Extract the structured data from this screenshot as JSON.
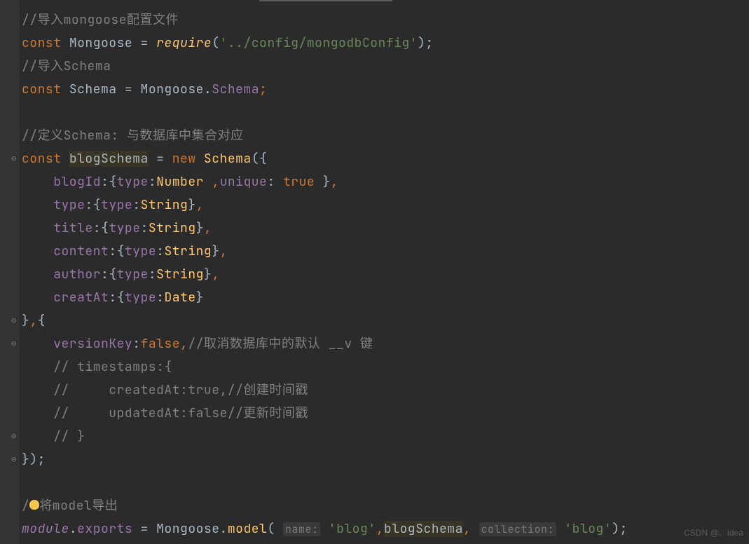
{
  "watermark": "CSDN @。Idea",
  "code_lines": [
    {
      "tokens": [
        {
          "t": "//导入mongoose配置文件",
          "c": "comment"
        }
      ]
    },
    {
      "tokens": [
        {
          "t": "const ",
          "c": "keyword"
        },
        {
          "t": "Mongoose ",
          "c": "identifier"
        },
        {
          "t": "= ",
          "c": "identifier"
        },
        {
          "t": "require",
          "c": "func-italic"
        },
        {
          "t": "(",
          "c": "identifier"
        },
        {
          "t": "'../config/mongodbConfig'",
          "c": "string"
        },
        {
          "t": ");",
          "c": "identifier"
        }
      ]
    },
    {
      "tokens": [
        {
          "t": "//导入Schema",
          "c": "comment"
        }
      ]
    },
    {
      "tokens": [
        {
          "t": "const ",
          "c": "keyword"
        },
        {
          "t": "Schema ",
          "c": "identifier"
        },
        {
          "t": "= Mongoose.",
          "c": "identifier"
        },
        {
          "t": "Schema",
          "c": "property"
        },
        {
          "t": ";",
          "c": "keyword"
        }
      ]
    },
    {
      "tokens": [
        {
          "t": "",
          "c": "identifier"
        }
      ]
    },
    {
      "tokens": [
        {
          "t": "//定义Schema: 与数据库中集合对应",
          "c": "comment"
        }
      ]
    },
    {
      "gutter": "⊖",
      "tokens": [
        {
          "t": "const ",
          "c": "keyword"
        },
        {
          "t": "blogSchema",
          "c": "identifier",
          "hl": true
        },
        {
          "t": " = ",
          "c": "identifier"
        },
        {
          "t": "new ",
          "c": "keyword"
        },
        {
          "t": "Schema",
          "c": "type-name"
        },
        {
          "t": "({",
          "c": "identifier"
        }
      ]
    },
    {
      "tokens": [
        {
          "t": "    ",
          "c": "identifier"
        },
        {
          "t": "blogId",
          "c": "property"
        },
        {
          "t": ":{",
          "c": "identifier"
        },
        {
          "t": "type",
          "c": "property"
        },
        {
          "t": ":",
          "c": "identifier"
        },
        {
          "t": "Number ",
          "c": "type-name"
        },
        {
          "t": ",",
          "c": "keyword"
        },
        {
          "t": "unique",
          "c": "property"
        },
        {
          "t": ": ",
          "c": "identifier"
        },
        {
          "t": "true ",
          "c": "keyword"
        },
        {
          "t": "}",
          "c": "identifier"
        },
        {
          "t": ",",
          "c": "keyword"
        }
      ]
    },
    {
      "tokens": [
        {
          "t": "    ",
          "c": "identifier"
        },
        {
          "t": "type",
          "c": "property"
        },
        {
          "t": ":{",
          "c": "identifier"
        },
        {
          "t": "type",
          "c": "property"
        },
        {
          "t": ":",
          "c": "identifier"
        },
        {
          "t": "String",
          "c": "type-name"
        },
        {
          "t": "}",
          "c": "identifier"
        },
        {
          "t": ",",
          "c": "keyword"
        }
      ]
    },
    {
      "tokens": [
        {
          "t": "    ",
          "c": "identifier"
        },
        {
          "t": "title",
          "c": "property"
        },
        {
          "t": ":{",
          "c": "identifier"
        },
        {
          "t": "type",
          "c": "property"
        },
        {
          "t": ":",
          "c": "identifier"
        },
        {
          "t": "String",
          "c": "type-name"
        },
        {
          "t": "}",
          "c": "identifier"
        },
        {
          "t": ",",
          "c": "keyword"
        }
      ]
    },
    {
      "tokens": [
        {
          "t": "    ",
          "c": "identifier"
        },
        {
          "t": "content",
          "c": "property"
        },
        {
          "t": ":{",
          "c": "identifier"
        },
        {
          "t": "type",
          "c": "property"
        },
        {
          "t": ":",
          "c": "identifier"
        },
        {
          "t": "String",
          "c": "type-name"
        },
        {
          "t": "}",
          "c": "identifier"
        },
        {
          "t": ",",
          "c": "keyword"
        }
      ]
    },
    {
      "tokens": [
        {
          "t": "    ",
          "c": "identifier"
        },
        {
          "t": "author",
          "c": "property"
        },
        {
          "t": ":{",
          "c": "identifier"
        },
        {
          "t": "type",
          "c": "property"
        },
        {
          "t": ":",
          "c": "identifier"
        },
        {
          "t": "String",
          "c": "type-name"
        },
        {
          "t": "}",
          "c": "identifier"
        },
        {
          "t": ",",
          "c": "keyword"
        }
      ]
    },
    {
      "tokens": [
        {
          "t": "    ",
          "c": "identifier"
        },
        {
          "t": "creatAt",
          "c": "property"
        },
        {
          "t": ":{",
          "c": "identifier"
        },
        {
          "t": "type",
          "c": "property"
        },
        {
          "t": ":",
          "c": "identifier"
        },
        {
          "t": "Date",
          "c": "type-name"
        },
        {
          "t": "}",
          "c": "identifier"
        }
      ]
    },
    {
      "gutter": "⊖",
      "tokens": [
        {
          "t": "}",
          "c": "identifier"
        },
        {
          "t": ",",
          "c": "keyword"
        },
        {
          "t": "{",
          "c": "identifier"
        }
      ]
    },
    {
      "gutter": "⊖",
      "tokens": [
        {
          "t": "    ",
          "c": "identifier"
        },
        {
          "t": "versionKey",
          "c": "property"
        },
        {
          "t": ":",
          "c": "identifier"
        },
        {
          "t": "false",
          "c": "keyword"
        },
        {
          "t": ",",
          "c": "keyword"
        },
        {
          "t": "//取消数据库中的默认 __v 键",
          "c": "comment"
        }
      ]
    },
    {
      "tokens": [
        {
          "t": "    // timestamps:{",
          "c": "comment"
        }
      ]
    },
    {
      "tokens": [
        {
          "t": "    //     createdAt:true,//创建时间戳",
          "c": "comment"
        }
      ]
    },
    {
      "tokens": [
        {
          "t": "    //     updatedAt:false//更新时间戳",
          "c": "comment"
        }
      ]
    },
    {
      "gutter": "⊖",
      "tokens": [
        {
          "t": "    // }",
          "c": "comment"
        }
      ]
    },
    {
      "gutter": "⊖",
      "tokens": [
        {
          "t": "});",
          "c": "identifier"
        }
      ]
    },
    {
      "tokens": [
        {
          "t": "",
          "c": "identifier"
        }
      ]
    },
    {
      "bulb": true,
      "tokens": [
        {
          "t": "/",
          "c": "comment"
        },
        {
          "t": "",
          "bulb": true
        },
        {
          "t": "将model导出",
          "c": "comment"
        }
      ]
    },
    {
      "tokens": [
        {
          "t": "module",
          "c": "property",
          "i": true
        },
        {
          "t": ".",
          "c": "identifier"
        },
        {
          "t": "exports",
          "c": "property"
        },
        {
          "t": " = Mongoose.",
          "c": "identifier"
        },
        {
          "t": "model",
          "c": "type-name"
        },
        {
          "t": "( ",
          "c": "identifier"
        },
        {
          "t": "name:",
          "hint": true
        },
        {
          "t": " ",
          "c": "identifier"
        },
        {
          "t": "'blog'",
          "c": "string"
        },
        {
          "t": ",",
          "c": "keyword"
        },
        {
          "t": "blogSchema",
          "c": "identifier",
          "hl": true
        },
        {
          "t": ",",
          "c": "keyword"
        },
        {
          "t": " ",
          "c": "identifier"
        },
        {
          "t": "collection:",
          "hint": true
        },
        {
          "t": " ",
          "c": "identifier"
        },
        {
          "t": "'blog'",
          "c": "string"
        },
        {
          "t": ");",
          "c": "identifier"
        }
      ]
    }
  ]
}
